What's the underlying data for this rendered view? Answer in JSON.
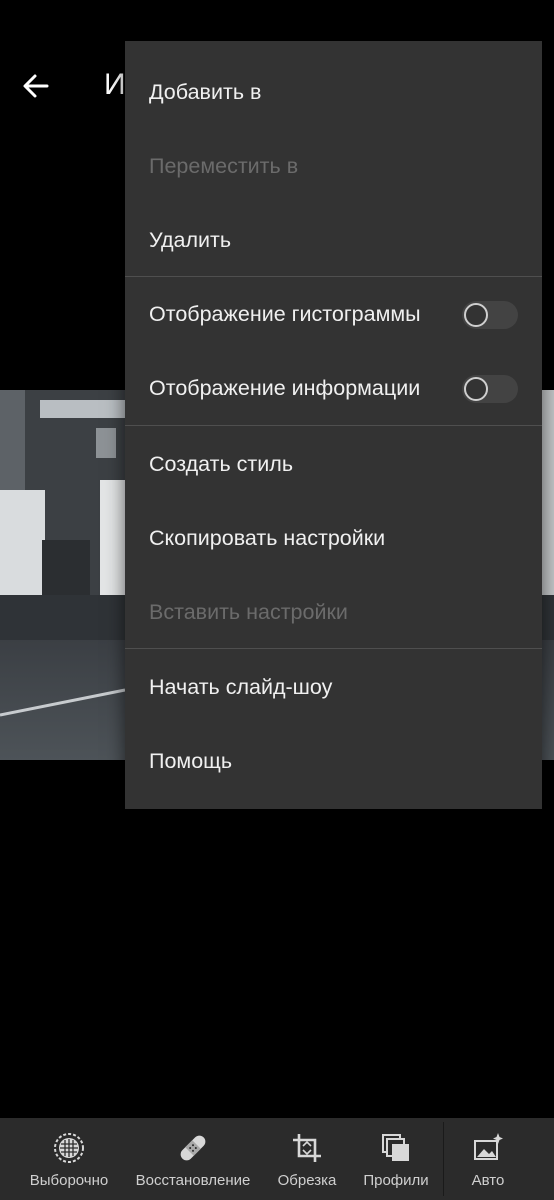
{
  "header": {
    "title": "И",
    "back_icon": "arrow-left-icon"
  },
  "menu": {
    "items": [
      {
        "label": "Добавить в",
        "enabled": true
      },
      {
        "label": "Переместить в",
        "enabled": false
      },
      {
        "label": "Удалить",
        "enabled": true
      },
      {
        "label": "Отображение гистограммы",
        "enabled": true,
        "toggle": false
      },
      {
        "label": "Отображение информации",
        "enabled": true,
        "toggle": false
      },
      {
        "label": "Создать стиль",
        "enabled": true
      },
      {
        "label": "Скопировать настройки",
        "enabled": true
      },
      {
        "label": "Вставить настройки",
        "enabled": false
      },
      {
        "label": "Начать слайд-шоу",
        "enabled": true
      },
      {
        "label": "Помощь",
        "enabled": true
      }
    ]
  },
  "toolbar": {
    "items": [
      {
        "label": "Выборочно",
        "icon": "selective-icon"
      },
      {
        "label": "Восстановление",
        "icon": "healing-bandage-icon"
      },
      {
        "label": "Обрезка",
        "icon": "crop-icon"
      },
      {
        "label": "Профили",
        "icon": "profiles-icon"
      },
      {
        "label": "Авто",
        "icon": "auto-enhance-icon"
      }
    ]
  },
  "colors": {
    "background": "#000000",
    "menu_bg": "#333333",
    "menu_text": "#f0f0f0",
    "menu_text_disabled": "#6b6b6b",
    "toolbar_bg": "#2b2b2b"
  }
}
